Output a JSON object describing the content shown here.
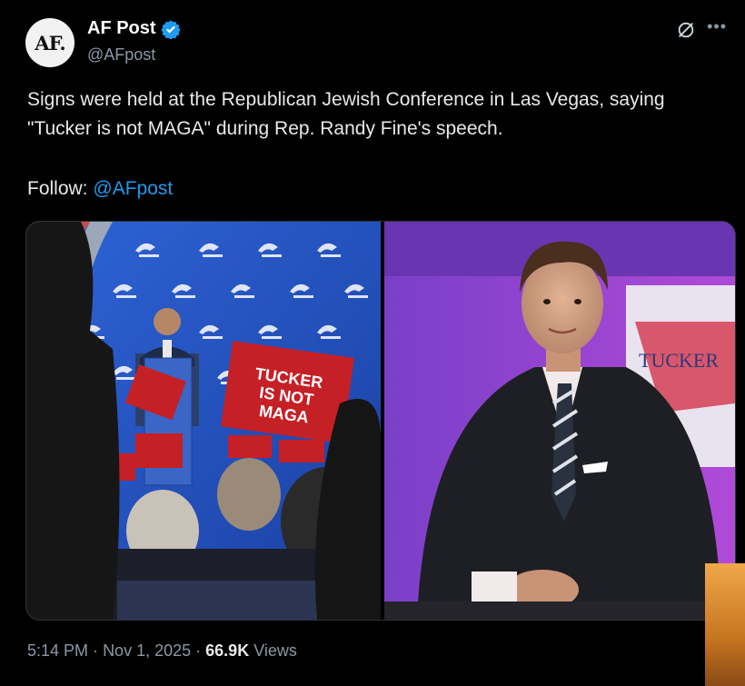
{
  "author": {
    "avatar_text": "AF.",
    "name": "AF Post",
    "handle": "@AFpost"
  },
  "tweet": {
    "text": "Signs were held at the Republican Jewish Conference in Las Vegas, saying \"Tucker is not MAGA\" during Rep. Randy Fine's speech.",
    "follow_label": "Follow:",
    "follow_handle": "@AFpost"
  },
  "media": {
    "left_signs": [
      "TUCKER",
      "IS NOT",
      "MAGA"
    ],
    "right_backdrop_text": "TUCKER"
  },
  "meta": {
    "time": "5:14 PM",
    "date": "Nov 1, 2025",
    "views_count": "66.9K",
    "views_label": "Views"
  },
  "colors": {
    "accent": "#1d9bf0",
    "background": "#000000",
    "muted": "#8b98a5"
  },
  "icons": [
    "verified-badge-icon",
    "grok-icon",
    "more-icon"
  ]
}
